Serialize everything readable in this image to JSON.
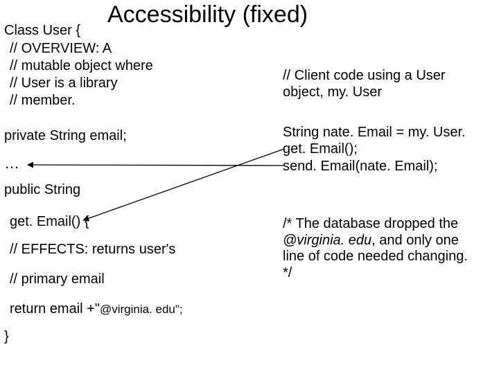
{
  "title": "Accessibility (fixed)",
  "left": {
    "class_open": "Class User {",
    "ov1": "// OVERVIEW:  A",
    "ov2": "// mutable object where",
    "ov3": "// User is a library",
    "ov4": "// member.",
    "private_kw": "private",
    "private_rest": " String email;",
    "ellipsis": "…",
    "public_kw": "public",
    "public_rest": " String",
    "getemail": "get. Email() {",
    "effects": "// EFFECTS: returns user's",
    "primary": "// primary email",
    "return_a": "return email +\"",
    "return_b": "@virginia. edu\";",
    "close": "}"
  },
  "right": {
    "client1": "// Client code using a User object, my. User",
    "nate": "String nate. Email = my. User. get. Email();",
    "send": "send. Email(nate. Email);",
    "db_a": "/*  The database dropped the ",
    "db_at": "@virginia. edu",
    "db_b": ", and only one line of code needed changing.   */"
  }
}
